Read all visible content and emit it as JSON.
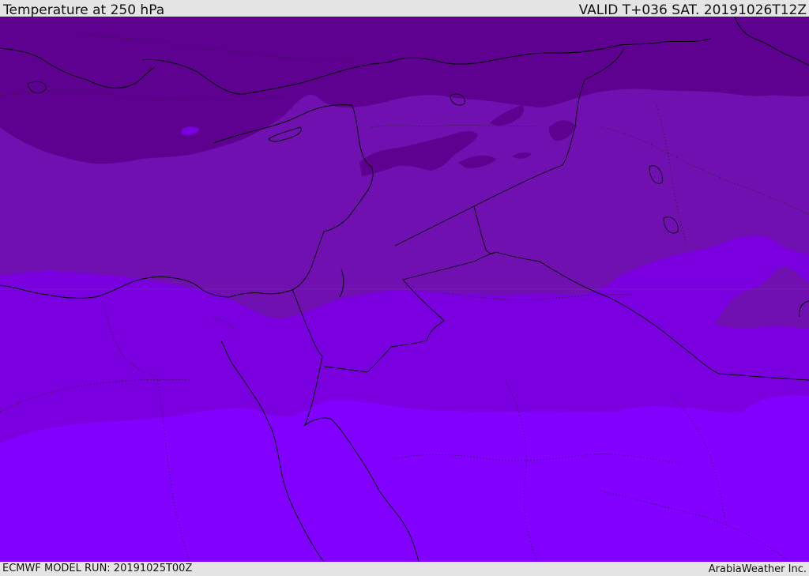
{
  "header": {
    "title": "Temperature at 250 hPa",
    "valid_time": "VALID T+036 SAT. 20191026T12Z"
  },
  "footer": {
    "model_run": "ECMWF MODEL RUN: 20191025T00Z",
    "credit": "ArabiaWeather Inc."
  },
  "map": {
    "field": "temperature",
    "level": "250 hPa",
    "band_colors": {
      "coldest": "#5e0090",
      "cold": "#7010b0",
      "mid": "#7a00e0",
      "warm": "#8200ff"
    },
    "boundary_color": "#000000"
  }
}
